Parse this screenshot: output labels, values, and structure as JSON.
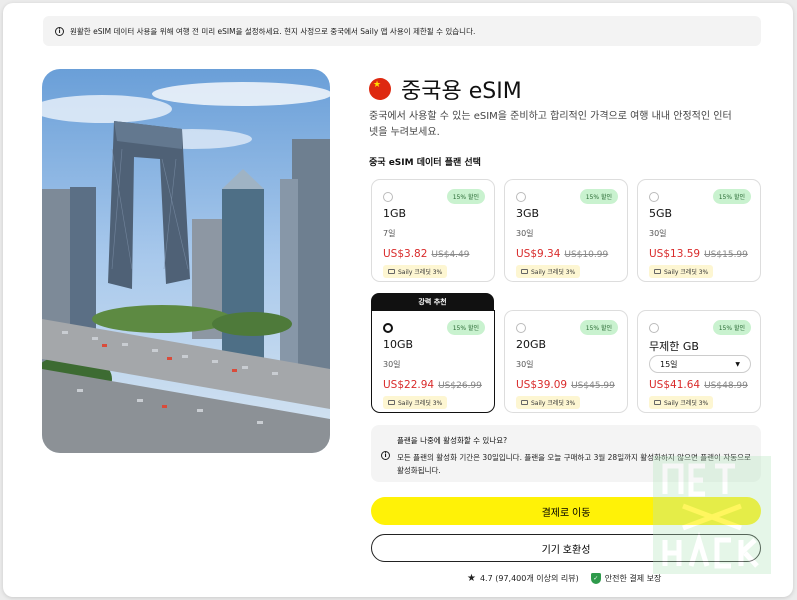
{
  "notice": {
    "text": "원활한 eSIM 데이터 사용을 위해 여행 전 미리 eSIM을 설정하세요. 현지 사정으로 중국에서 Saily 앱 사용이 제한될 수 있습니다."
  },
  "product": {
    "title": "중국용 eSIM",
    "description": "중국에서 사용할 수 있는 eSIM을 준비하고 합리적인 가격으로 여행 내내 안정적인 인터넷을 누려보세요.",
    "plans_heading": "중국 eSIM 데이터 플랜 선택"
  },
  "plans": [
    {
      "size": "1GB",
      "days": "7일",
      "price": "US$3.82",
      "old": "US$4.49",
      "badge": "15% 할인",
      "credit": "Saily 크레딧 3%"
    },
    {
      "size": "3GB",
      "days": "30일",
      "price": "US$9.34",
      "old": "US$10.99",
      "badge": "15% 할인",
      "credit": "Saily 크레딧 3%"
    },
    {
      "size": "5GB",
      "days": "30일",
      "price": "US$13.59",
      "old": "US$15.99",
      "badge": "15% 할인",
      "credit": "Saily 크레딧 3%"
    },
    {
      "size": "10GB",
      "days": "30일",
      "price": "US$22.94",
      "old": "US$26.99",
      "badge": "15% 할인",
      "credit": "Saily 크레딧 3%",
      "ribbon": "강력 추천"
    },
    {
      "size": "20GB",
      "days": "30일",
      "price": "US$39.09",
      "old": "US$45.99",
      "badge": "15% 할인",
      "credit": "Saily 크레딧 3%"
    },
    {
      "size": "무제한 GB",
      "days": "15일",
      "price": "US$41.64",
      "old": "US$48.99",
      "badge": "15% 할인",
      "credit": "Saily 크레딧 3%"
    }
  ],
  "activation": {
    "question": "플랜을 나중에 활성화할 수 있나요?",
    "answer": "모든 플랜의 활성화 기간은 30일입니다. 플랜을 오늘 구매하고 3월 28일까지 활성화하지 않으면 플랜이 자동으로 활성화됩니다."
  },
  "buttons": {
    "pay": "결제로 이동",
    "compat": "기기 호환성"
  },
  "footer": {
    "rating": "4.7 (97,400개 이상의 리뷰)",
    "secure": "안전한 결제 보장"
  },
  "colors": {
    "accent": "#fff207",
    "sale": "#d92b2b",
    "badge_bg": "#c9f2cf"
  },
  "icons": [
    "info-icon",
    "china-flag-icon",
    "credit-icon",
    "caret-down-icon",
    "star-icon",
    "shield-check-icon"
  ]
}
